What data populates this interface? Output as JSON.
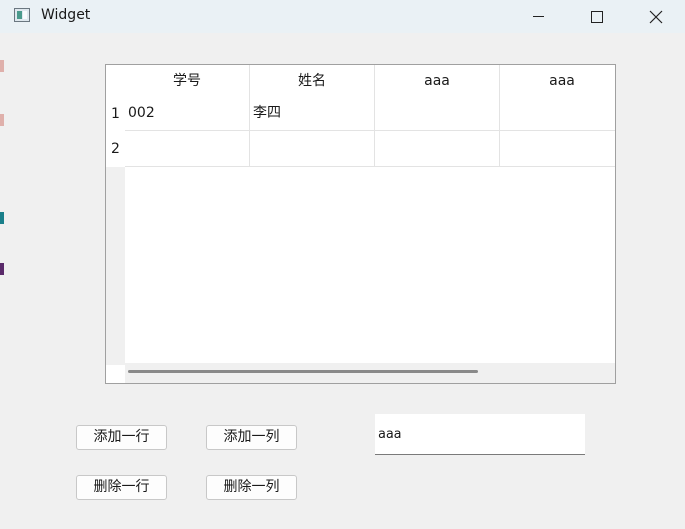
{
  "window": {
    "title": "Widget",
    "controls": {
      "minimize": "minimize-icon",
      "maximize": "maximize-icon",
      "close": "close-icon"
    }
  },
  "table": {
    "columns": [
      "学号",
      "姓名",
      "aaa",
      "aaa"
    ],
    "row_numbers": [
      "1",
      "2"
    ],
    "rows": [
      [
        "002",
        "李四",
        "",
        ""
      ],
      [
        "",
        "",
        "",
        ""
      ]
    ]
  },
  "buttons": {
    "add_row": "添加一行",
    "add_column": "添加一列",
    "delete_row": "删除一行",
    "delete_column": "删除一列"
  },
  "input": {
    "value": "aaa"
  },
  "colors": {
    "titlebar": "#eaf1f5",
    "window_bg": "#f0f0f0",
    "table_bg": "#ffffff",
    "scroll_thumb": "#8a8a8a"
  }
}
